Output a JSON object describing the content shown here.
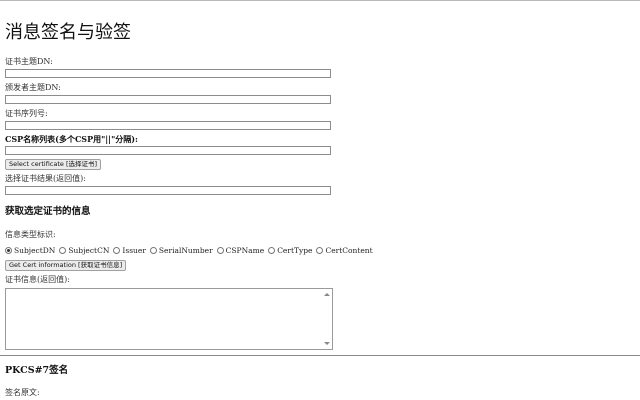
{
  "page": {
    "title": "消息签名与验签"
  },
  "cert_form": {
    "subject_dn_label": "证书主题DN:",
    "subject_dn_value": "",
    "issuer_dn_label": "颁发者主题DN:",
    "issuer_dn_value": "",
    "serial_label": "证书序列号:",
    "serial_value": "",
    "csp_label": "CSP名称列表(多个CSP用\"||\"分隔):",
    "csp_value": "",
    "select_button": "Select certificate [选择证书]",
    "result_label": "选择证书结果(返回值):",
    "result_value": ""
  },
  "cert_info": {
    "heading": "获取选定证书的信息",
    "type_label": "信息类型标识:",
    "options": [
      {
        "label": "SubjectDN",
        "selected": true
      },
      {
        "label": "SubjectCN",
        "selected": false
      },
      {
        "label": "Issuer",
        "selected": false
      },
      {
        "label": "SerialNumber",
        "selected": false
      },
      {
        "label": "CSPName",
        "selected": false
      },
      {
        "label": "CertType",
        "selected": false
      },
      {
        "label": "CertContent",
        "selected": false
      }
    ],
    "get_button": "Get Cert information [获取证书信息]",
    "info_label": "证书信息(返回值):",
    "info_value": ""
  },
  "pkcs7": {
    "heading": "PKCS#7签名",
    "plaintext_label": "签名原文:"
  }
}
